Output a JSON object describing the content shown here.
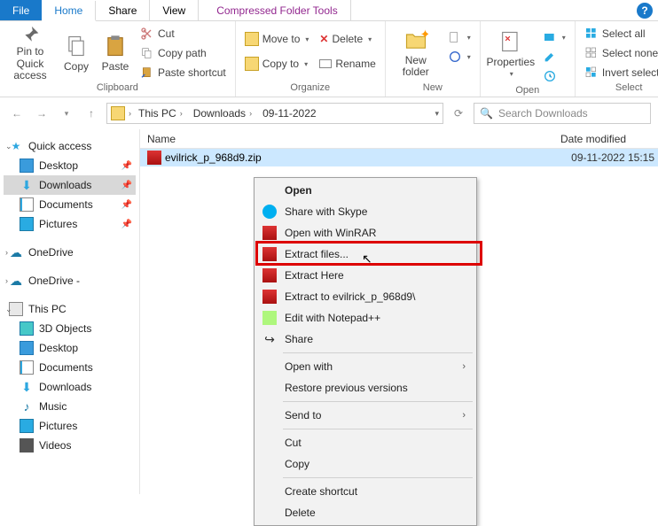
{
  "tabs": {
    "file": "File",
    "home": "Home",
    "share": "Share",
    "view": "View",
    "tool": "Compressed Folder Tools"
  },
  "ribbon": {
    "clipboard": {
      "pin": "Pin to Quick\naccess",
      "copy": "Copy",
      "paste": "Paste",
      "cut": "Cut",
      "copypath": "Copy path",
      "pasteshortcut": "Paste shortcut",
      "label": "Clipboard"
    },
    "organize": {
      "moveto": "Move to",
      "copyto": "Copy to",
      "delete": "Delete",
      "rename": "Rename",
      "label": "Organize"
    },
    "new": {
      "newfolder": "New\nfolder",
      "label": "New"
    },
    "open": {
      "properties": "Properties",
      "label": "Open"
    },
    "select": {
      "all": "Select all",
      "none": "Select none",
      "invert": "Invert selection",
      "label": "Select"
    }
  },
  "breadcrumb": {
    "root": "This PC",
    "a": "Downloads",
    "b": "09-11-2022"
  },
  "search_placeholder": "Search Downloads",
  "columns": {
    "name": "Name",
    "date": "Date modified"
  },
  "nav": {
    "quick": "Quick access",
    "desk": "Desktop",
    "dl": "Downloads",
    "docs": "Documents",
    "pics": "Pictures",
    "od": "OneDrive",
    "od2": "OneDrive -",
    "pc": "This PC",
    "cube": "3D Objects",
    "desk2": "Desktop",
    "docs2": "Documents",
    "dl2": "Downloads",
    "music": "Music",
    "pics2": "Pictures",
    "vids": "Videos"
  },
  "file": {
    "name": "evilrick_p_968d9.zip",
    "date": "09-11-2022 15:15"
  },
  "ctx": {
    "open": "Open",
    "skype": "Share with Skype",
    "winrar": "Open with WinRAR",
    "extractfiles": "Extract files...",
    "extracthere": "Extract Here",
    "extractto": "Extract to evilrick_p_968d9\\",
    "notepad": "Edit with Notepad++",
    "share": "Share",
    "openwith": "Open with",
    "restore": "Restore previous versions",
    "sendto": "Send to",
    "cut": "Cut",
    "copy": "Copy",
    "shortcut": "Create shortcut",
    "delete": "Delete"
  }
}
